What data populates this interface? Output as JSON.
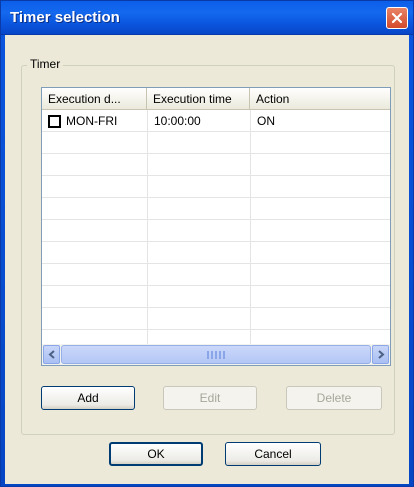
{
  "window": {
    "title": "Timer selection",
    "close_icon": "close-icon"
  },
  "group": {
    "label": "Timer"
  },
  "list": {
    "columns": [
      "Execution d...",
      "Execution time",
      "Action"
    ],
    "rows": [
      {
        "checked": false,
        "day": "MON-FRI",
        "time": "10:00:00",
        "action": "ON"
      }
    ],
    "scrollbar": {
      "grip": "III"
    }
  },
  "buttons": {
    "add": "Add",
    "edit": "Edit",
    "delete": "Delete",
    "ok": "OK",
    "cancel": "Cancel"
  },
  "colors": {
    "titlebar": "#0a55dd",
    "close": "#d24a2a",
    "face": "#ece9d8"
  }
}
